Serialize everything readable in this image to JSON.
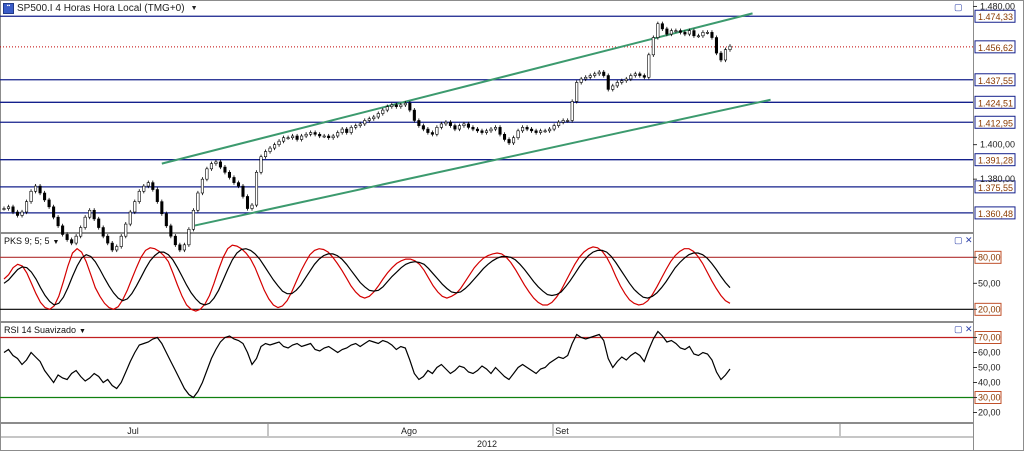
{
  "header": {
    "title": "SP500.I 4 Horas Hora Local (TMG+0)",
    "icon": "chart-instrument-icon"
  },
  "panels": {
    "stoch": {
      "title": "PKS 9; 5; 5"
    },
    "rsi": {
      "title": "RSI 14 Suavizado"
    }
  },
  "colors": {
    "channel": "#3c9a6e",
    "hline": "#14208c",
    "price_dotted": "#c00000",
    "stoch_k": "#000000",
    "stoch_d": "#d40000",
    "rsi_line": "#000000",
    "rsi_upper": "#c02020",
    "rsi_lower": "#108010",
    "label_text": "#8a3a00"
  },
  "chart_data": [
    {
      "type": "candlestick",
      "panel": "price",
      "title": "SP500.I 4 Horas Hora Local (TMG+0)",
      "y_ticks": [
        "1.480,00",
        "1.400,00",
        "1.380,00"
      ],
      "ylim": [
        1350,
        1482
      ],
      "horizontal_levels": [
        1474.33,
        1456.62,
        1437.55,
        1424.51,
        1412.95,
        1391.28,
        1375.55,
        1360.48
      ],
      "level_labels": [
        "1.474,33",
        "1.456,62",
        "1.437,55",
        "1.424,51",
        "1.412,95",
        "1.391,28",
        "1.375,55",
        "1.360,48"
      ],
      "current_price": 1456.62,
      "closes": [
        1363,
        1364,
        1361,
        1359,
        1361,
        1367,
        1373,
        1376,
        1372,
        1368,
        1364,
        1358,
        1353,
        1348,
        1345,
        1343,
        1347,
        1352,
        1358,
        1362,
        1357,
        1352,
        1347,
        1343,
        1339,
        1341,
        1347,
        1354,
        1361,
        1367,
        1373,
        1376,
        1378,
        1374,
        1367,
        1360,
        1353,
        1347,
        1342,
        1339,
        1342,
        1351,
        1362,
        1372,
        1380,
        1386,
        1389,
        1390,
        1387,
        1384,
        1381,
        1378,
        1376,
        1370,
        1363,
        1365,
        1384,
        1393,
        1396,
        1398,
        1400,
        1402,
        1404,
        1404,
        1405,
        1403,
        1405,
        1406,
        1407,
        1406,
        1405,
        1405,
        1404,
        1405,
        1407,
        1409,
        1407,
        1410,
        1411,
        1412,
        1414,
        1415,
        1416,
        1418,
        1420,
        1422,
        1423,
        1422,
        1423,
        1424,
        1420,
        1414,
        1411,
        1409,
        1407,
        1406,
        1410,
        1412,
        1413,
        1411,
        1409,
        1411,
        1412,
        1410,
        1409,
        1408,
        1407,
        1408,
        1409,
        1410,
        1406,
        1403,
        1401,
        1404,
        1408,
        1410,
        1409,
        1408,
        1407,
        1408,
        1408,
        1409,
        1411,
        1413,
        1414,
        1414,
        1425,
        1436,
        1438,
        1439,
        1440,
        1441,
        1442,
        1440,
        1432,
        1434,
        1436,
        1437,
        1438,
        1440,
        1441,
        1440,
        1439,
        1452,
        1462,
        1470,
        1467,
        1464,
        1466,
        1466,
        1465,
        1464,
        1466,
        1463,
        1463,
        1465,
        1465,
        1462,
        1453,
        1449,
        1455,
        1457
      ],
      "levels_note": "",
      "channel_upper": {
        "from": [
          1389,
          1388
        ],
        "to": [
          1476,
          1476
        ]
      },
      "channel_lower": {
        "from": [
          1353,
          1353
        ],
        "to": [
          1426,
          1426
        ]
      },
      "x_labels": [
        "Jul",
        "Ago",
        "Set"
      ],
      "year_label": "2012"
    },
    {
      "type": "line",
      "panel": "stochastic",
      "title": "PKS 9; 5; 5",
      "y_ticks": [
        "80,00",
        "50,00",
        "20,00"
      ],
      "levels": [
        80,
        20
      ],
      "ylim": [
        10,
        100
      ],
      "series": [
        {
          "values": [
            55,
            60,
            68,
            72,
            70,
            62,
            50,
            38,
            28,
            22,
            20,
            24,
            35,
            52,
            70,
            85,
            90,
            86,
            75,
            60,
            45,
            35,
            27,
            22,
            20,
            23,
            31,
            42,
            55,
            68,
            80,
            88,
            91,
            90,
            87,
            82,
            75,
            62,
            48,
            35,
            25,
            20,
            18,
            20,
            26,
            36,
            50,
            66,
            80,
            90,
            94,
            93,
            90,
            85,
            78,
            68,
            55,
            42,
            32,
            25,
            22,
            24,
            30,
            40,
            52,
            64,
            74,
            83,
            88,
            90,
            89,
            86,
            80,
            73,
            65,
            56,
            47,
            40,
            35,
            33,
            35,
            40,
            47,
            55,
            62,
            68,
            73,
            76,
            78,
            78,
            76,
            72,
            65,
            56,
            47,
            40,
            35,
            33,
            35,
            38,
            44,
            52,
            60,
            68,
            74,
            79,
            82,
            84,
            85,
            84,
            80,
            74,
            66,
            57,
            48,
            40,
            33,
            28,
            25,
            25,
            28,
            34,
            42,
            52,
            62,
            72,
            80,
            86,
            90,
            92,
            91,
            87,
            80,
            70,
            58,
            47,
            38,
            31,
            27,
            25,
            26,
            30,
            37,
            46,
            56,
            66,
            75,
            82,
            87,
            90,
            90,
            87,
            81,
            73,
            63,
            53,
            44,
            36,
            30,
            27
          ]
        },
        {
          "values": [
            50,
            54,
            60,
            66,
            69,
            68,
            63,
            55,
            45,
            36,
            29,
            25,
            27,
            34,
            45,
            58,
            70,
            79,
            83,
            81,
            75,
            66,
            56,
            47,
            39,
            33,
            30,
            32,
            38,
            47,
            57,
            67,
            76,
            82,
            86,
            86,
            83,
            77,
            68,
            58,
            48,
            39,
            32,
            27,
            25,
            27,
            33,
            42,
            54,
            66,
            77,
            85,
            89,
            90,
            88,
            84,
            78,
            70,
            62,
            54,
            47,
            41,
            38,
            38,
            42,
            48,
            56,
            64,
            72,
            78,
            82,
            84,
            84,
            82,
            78,
            72,
            65,
            58,
            51,
            46,
            42,
            41,
            42,
            46,
            52,
            58,
            63,
            68,
            72,
            74,
            75,
            74,
            72,
            67,
            61,
            55,
            49,
            44,
            40,
            39,
            40,
            44,
            49,
            55,
            61,
            67,
            72,
            76,
            79,
            81,
            81,
            80,
            77,
            72,
            66,
            59,
            52,
            46,
            41,
            37,
            36,
            37,
            40,
            46,
            53,
            61,
            69,
            76,
            82,
            86,
            88,
            88,
            86,
            81,
            74,
            66,
            58,
            50,
            43,
            38,
            34,
            33,
            35,
            39,
            45,
            52,
            60,
            68,
            74,
            79,
            83,
            85,
            85,
            83,
            79,
            73,
            66,
            58,
            51,
            45
          ]
        }
      ]
    },
    {
      "type": "line",
      "panel": "rsi",
      "title": "RSI 14 Suavizado",
      "y_ticks": [
        "70,00",
        "60,00",
        "50,00",
        "40,00",
        "30,00",
        "20,00"
      ],
      "levels": [
        70,
        30
      ],
      "ylim": [
        15,
        75
      ],
      "series": [
        {
          "values": [
            60,
            62,
            58,
            56,
            52,
            55,
            60,
            57,
            54,
            48,
            44,
            40,
            45,
            43,
            42,
            46,
            48,
            44,
            41,
            43,
            46,
            44,
            40,
            42,
            38,
            36,
            40,
            47,
            54,
            60,
            65,
            66,
            67,
            69,
            70,
            66,
            60,
            54,
            48,
            42,
            36,
            32,
            30,
            34,
            40,
            48,
            56,
            62,
            67,
            70,
            71,
            69,
            68,
            66,
            60,
            52,
            56,
            64,
            66,
            65,
            66,
            67,
            64,
            63,
            65,
            66,
            64,
            65,
            66,
            62,
            61,
            63,
            64,
            62,
            60,
            62,
            63,
            65,
            66,
            64,
            66,
            68,
            67,
            66,
            68,
            67,
            65,
            62,
            64,
            63,
            55,
            46,
            42,
            44,
            48,
            46,
            50,
            52,
            49,
            46,
            48,
            51,
            50,
            47,
            46,
            48,
            51,
            49,
            46,
            50,
            47,
            44,
            42,
            46,
            50,
            52,
            50,
            48,
            46,
            49,
            50,
            53,
            55,
            57,
            56,
            58,
            66,
            72,
            70,
            69,
            70,
            71,
            72,
            68,
            56,
            50,
            54,
            57,
            55,
            58,
            60,
            58,
            54,
            62,
            69,
            74,
            71,
            67,
            68,
            66,
            63,
            62,
            64,
            59,
            58,
            60,
            59,
            55,
            47,
            42,
            45,
            49
          ]
        }
      ]
    }
  ]
}
